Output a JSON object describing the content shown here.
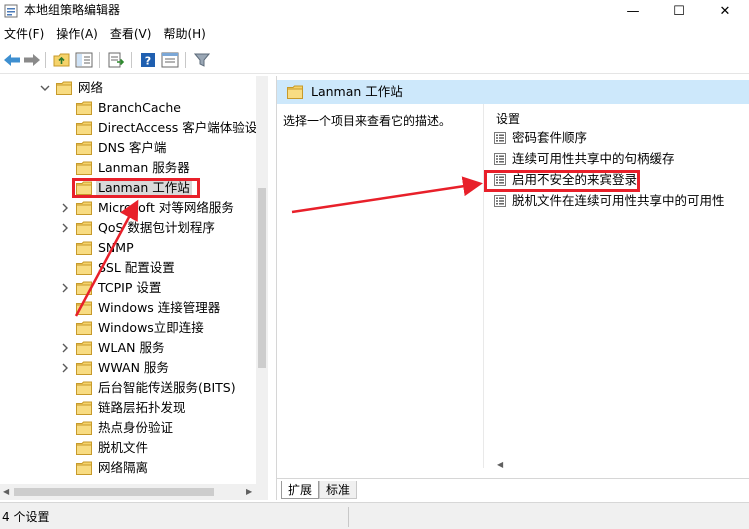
{
  "window": {
    "title": "本地组策略编辑器",
    "controls": {
      "minimize": "—",
      "maximize": "☐",
      "close": "✕"
    }
  },
  "menu": {
    "items": [
      "文件(F)",
      "操作(A)",
      "查看(V)",
      "帮助(H)"
    ]
  },
  "toolbar": {
    "buttons": [
      "back-icon",
      "forward-icon",
      "up-folder-icon",
      "show-hide-tree-icon",
      "export-list-icon",
      "help-icon",
      "properties-icon",
      "filter-icon"
    ]
  },
  "tree": {
    "items": [
      {
        "label": "网络",
        "expander": "open",
        "level": 0
      },
      {
        "label": "BranchCache",
        "expander": "none",
        "level": 1
      },
      {
        "label": "DirectAccess 客户端体验设置",
        "expander": "none",
        "level": 1
      },
      {
        "label": "DNS 客户端",
        "expander": "none",
        "level": 1
      },
      {
        "label": "Lanman 服务器",
        "expander": "none",
        "level": 1
      },
      {
        "label": "Lanman 工作站",
        "expander": "none",
        "level": 1,
        "selected": true
      },
      {
        "label": "Microsoft 对等网络服务",
        "expander": "closed",
        "level": 1
      },
      {
        "label": "QoS 数据包计划程序",
        "expander": "closed",
        "level": 1
      },
      {
        "label": "SNMP",
        "expander": "none",
        "level": 1
      },
      {
        "label": "SSL 配置设置",
        "expander": "none",
        "level": 1
      },
      {
        "label": "TCPIP 设置",
        "expander": "closed",
        "level": 1
      },
      {
        "label": "Windows 连接管理器",
        "expander": "none",
        "level": 1
      },
      {
        "label": "Windows立即连接",
        "expander": "none",
        "level": 1
      },
      {
        "label": "WLAN 服务",
        "expander": "closed",
        "level": 1
      },
      {
        "label": "WWAN 服务",
        "expander": "closed",
        "level": 1
      },
      {
        "label": "后台智能传送服务(BITS)",
        "expander": "none",
        "level": 1
      },
      {
        "label": "链路层拓扑发现",
        "expander": "none",
        "level": 1
      },
      {
        "label": "热点身份验证",
        "expander": "none",
        "level": 1
      },
      {
        "label": "脱机文件",
        "expander": "none",
        "level": 1
      },
      {
        "label": "网络隔离",
        "expander": "none",
        "level": 1
      }
    ]
  },
  "right": {
    "header_title": "Lanman 工作站",
    "description": "选择一个项目来查看它的描述。",
    "column_header": "设置",
    "settings": [
      "密码套件顺序",
      "连续可用性共享中的句柄缓存",
      "启用不安全的来宾登录",
      "脱机文件在连续可用性共享中的可用性"
    ],
    "tabs": [
      "扩展",
      "标准"
    ]
  },
  "status": {
    "text": "4 个设置"
  },
  "colors": {
    "selection": "#d9d9d9",
    "header_band": "#cde8fb",
    "annotation_red": "#e8202a",
    "folder_yellow": "#f5d36b"
  }
}
